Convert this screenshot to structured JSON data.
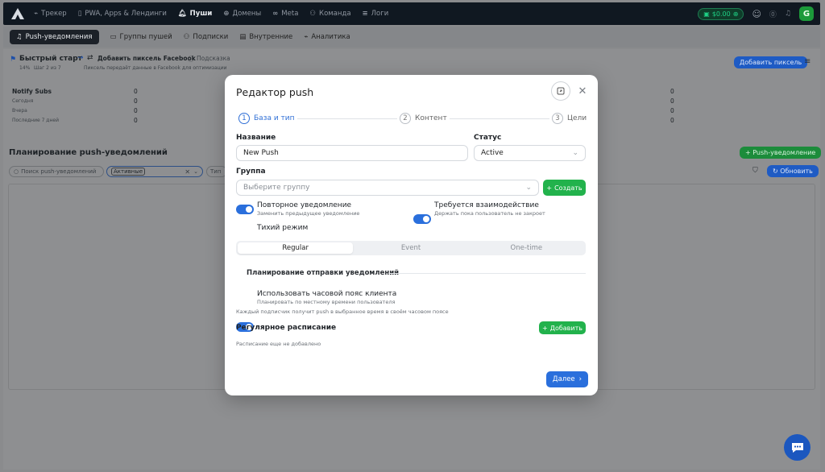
{
  "topbar": {
    "nav": [
      {
        "label": "Трекер",
        "icon": "chart-icon"
      },
      {
        "label": "PWA, Apps & Лендинги",
        "icon": "phone-icon"
      },
      {
        "label": "Пуши",
        "icon": "bell-icon"
      },
      {
        "label": "Домены",
        "icon": "globe-icon"
      },
      {
        "label": "Meta",
        "icon": "infinity-icon"
      },
      {
        "label": "Команда",
        "icon": "team-icon"
      },
      {
        "label": "Логи",
        "icon": "list-icon"
      }
    ],
    "balance": "$0.00",
    "user_initial": "G"
  },
  "subtabs": [
    {
      "label": "Push-уведомления"
    },
    {
      "label": "Группы пушей"
    },
    {
      "label": "Подписки"
    },
    {
      "label": "Внутренние"
    },
    {
      "label": "Аналитика"
    }
  ],
  "quickstart": {
    "title": "Быстрый старт",
    "progress": "14%",
    "step": "Шаг 2 из 7",
    "action_title": "Добавить пиксель Facebook",
    "hint": "Подсказка",
    "description": "Пиксель передаёт данные в Facebook для оптимизации",
    "add_pixel_button": "Добавить пиксель"
  },
  "stats": {
    "heading": "Notify Subs",
    "rows": [
      {
        "label": "Сегодня",
        "value": "0"
      },
      {
        "label": "Вчера",
        "value": "0"
      },
      {
        "label": "Последние 7 дней",
        "value": "0"
      }
    ],
    "header_value": "0",
    "right_values": [
      "0",
      "0",
      "0",
      "0"
    ]
  },
  "planning": {
    "title": "Планирование push-уведомлений",
    "search_placeholder": "Поиск push-уведомлений",
    "filter_status": "Активные",
    "filter_type": "Тип",
    "new_push_button": "Push-уведомление",
    "refresh_button": "Обновить"
  },
  "modal": {
    "title": "Редактор push",
    "steps": [
      {
        "num": "1",
        "label": "База и тип"
      },
      {
        "num": "2",
        "label": "Контент"
      },
      {
        "num": "3",
        "label": "Цели"
      }
    ],
    "name_label": "Название",
    "name_value": "New Push",
    "status_label": "Статус",
    "status_value": "Active",
    "group_label": "Группа",
    "group_placeholder": "Выберите группу",
    "create_button": "Создать",
    "toggles": {
      "repeat_title": "Повторное уведомление",
      "repeat_sub": "Заменить предыдущее уведомление",
      "interaction_title": "Требуется взаимодействие",
      "interaction_sub": "Держать пока пользователь не закроет",
      "silent_title": "Тихий режим"
    },
    "types": [
      "Regular",
      "Event",
      "One-time"
    ],
    "selected_type": "Regular",
    "schedule_section": "Планирование отправки уведомлений",
    "tz_title": "Использовать часовой пояс клиента",
    "tz_sub": "Планировать по местному времени пользователя",
    "tz_note": "Каждый подписчик получит push в выбранное время в своём часовом поясе",
    "regular_schedule_label": "Регулярное расписание",
    "add_button": "Добавить",
    "empty_schedule": "Расписание еще не добавлено",
    "next_button": "Далее"
  },
  "colors": {
    "primary": "#2a6fdc",
    "success": "#22b24c",
    "overlay": "#8a8b8d",
    "topbar": "#101821"
  }
}
